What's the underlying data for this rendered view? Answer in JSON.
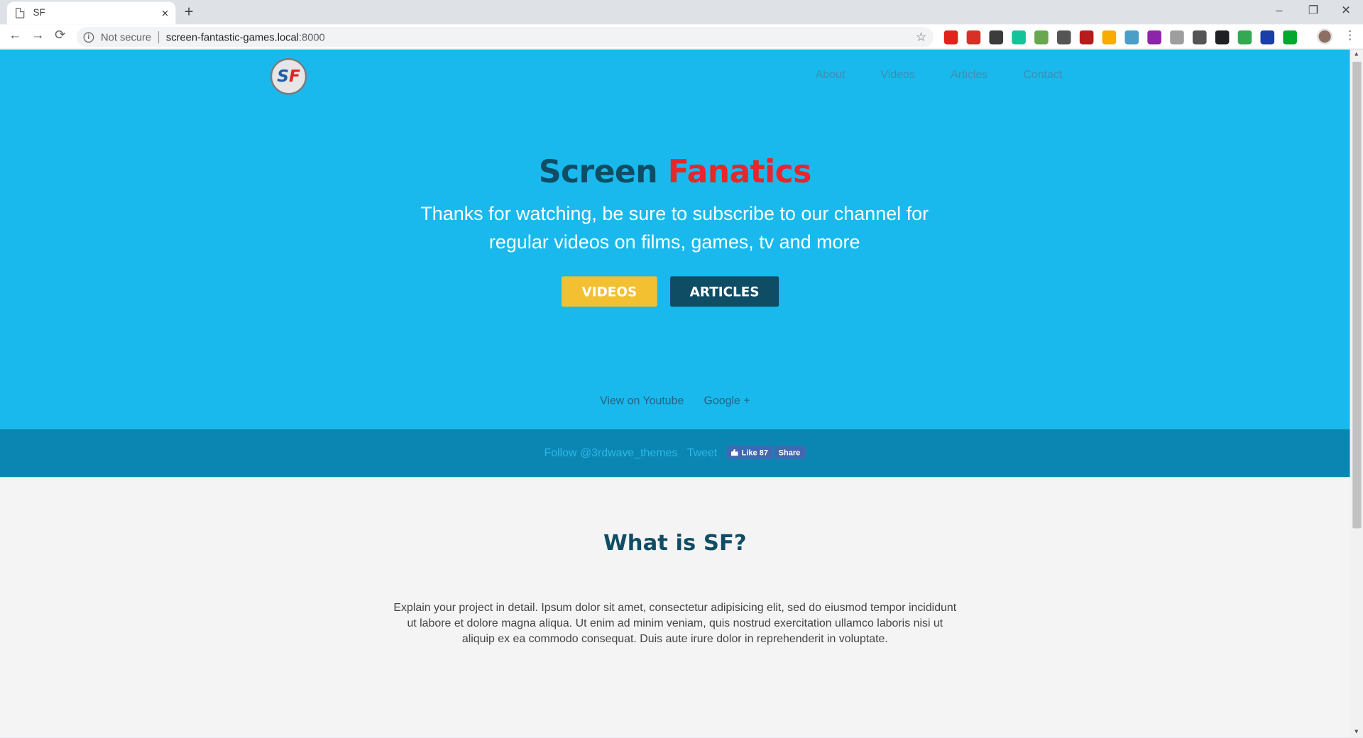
{
  "browser": {
    "tab_title": "SF",
    "tab_close": "×",
    "new_tab": "+",
    "window": {
      "minimize": "–",
      "restore": "❐",
      "close": "✕"
    },
    "nav": {
      "back": "←",
      "forward": "→",
      "reload": "⟳"
    },
    "security_label": "Not secure",
    "url_host": "screen-fantastic-games.local",
    "url_port": ":8000",
    "bookmark_icon": "☆",
    "menu": "⋮",
    "extensions": [
      {
        "name": "opera-ext-icon",
        "color": "#e2231a"
      },
      {
        "name": "red-square-ext-icon",
        "color": "#d93025"
      },
      {
        "name": "tampermonkey-ext-icon",
        "color": "#3c3c3c"
      },
      {
        "name": "grammarly-ext-icon",
        "color": "#15c39a"
      },
      {
        "name": "mail-ext-icon",
        "color": "#6aa84f"
      },
      {
        "name": "cursor-ext-icon",
        "color": "#555555"
      },
      {
        "name": "chart-ext-icon",
        "color": "#b71c1c"
      },
      {
        "name": "bulb-ext-icon",
        "color": "#f9ab00"
      },
      {
        "name": "eye-ext-icon",
        "color": "#4a9fc8"
      },
      {
        "name": "color-wheel-ext-icon",
        "color": "#8e24aa"
      },
      {
        "name": "grey-ext-icon",
        "color": "#9e9e9e"
      },
      {
        "name": "info-ext-icon",
        "color": "#555555"
      },
      {
        "name": "glasses-ext-icon",
        "color": "#202124"
      },
      {
        "name": "rainbow-ext-icon",
        "color": "#34a853"
      },
      {
        "name": "hash-ext-icon",
        "color": "#1a3fa8"
      },
      {
        "name": "evernote-ext-icon",
        "color": "#00a82d"
      }
    ]
  },
  "site": {
    "logo_s": "S",
    "logo_f": "F",
    "nav": [
      "About",
      "Videos",
      "Articles",
      "Contact"
    ],
    "hero": {
      "title_part1": "Screen",
      "title_part2": "Fanatics",
      "subtitle": "Thanks for watching, be sure to subscribe to our channel for regular videos on films, games, tv and more",
      "btn_videos": "VIDEOS",
      "btn_articles": "ARTICLES",
      "link_youtube": "View on Youtube",
      "link_google": "Google +"
    },
    "social": {
      "follow": "Follow @3rdwave_themes",
      "tweet": "Tweet",
      "fb_like": "Like 87",
      "fb_share": "Share"
    },
    "about": {
      "title": "What is SF?",
      "text": "Explain your project in detail. Ipsum dolor sit amet, consectetur adipisicing elit, sed do eiusmod tempor incididunt ut labore et dolore magna aliqua. Ut enim ad minim veniam, quis nostrud exercitation ullamco laboris nisi ut aliquip ex ea commodo consequat. Duis aute irure dolor in reprehenderit in voluptate."
    }
  },
  "colors": {
    "hero_bg": "#19b9ed",
    "social_bg": "#0b86b3",
    "title_dark": "#0f4d65",
    "title_red": "#e8262b",
    "btn_yellow": "#f2c030"
  }
}
